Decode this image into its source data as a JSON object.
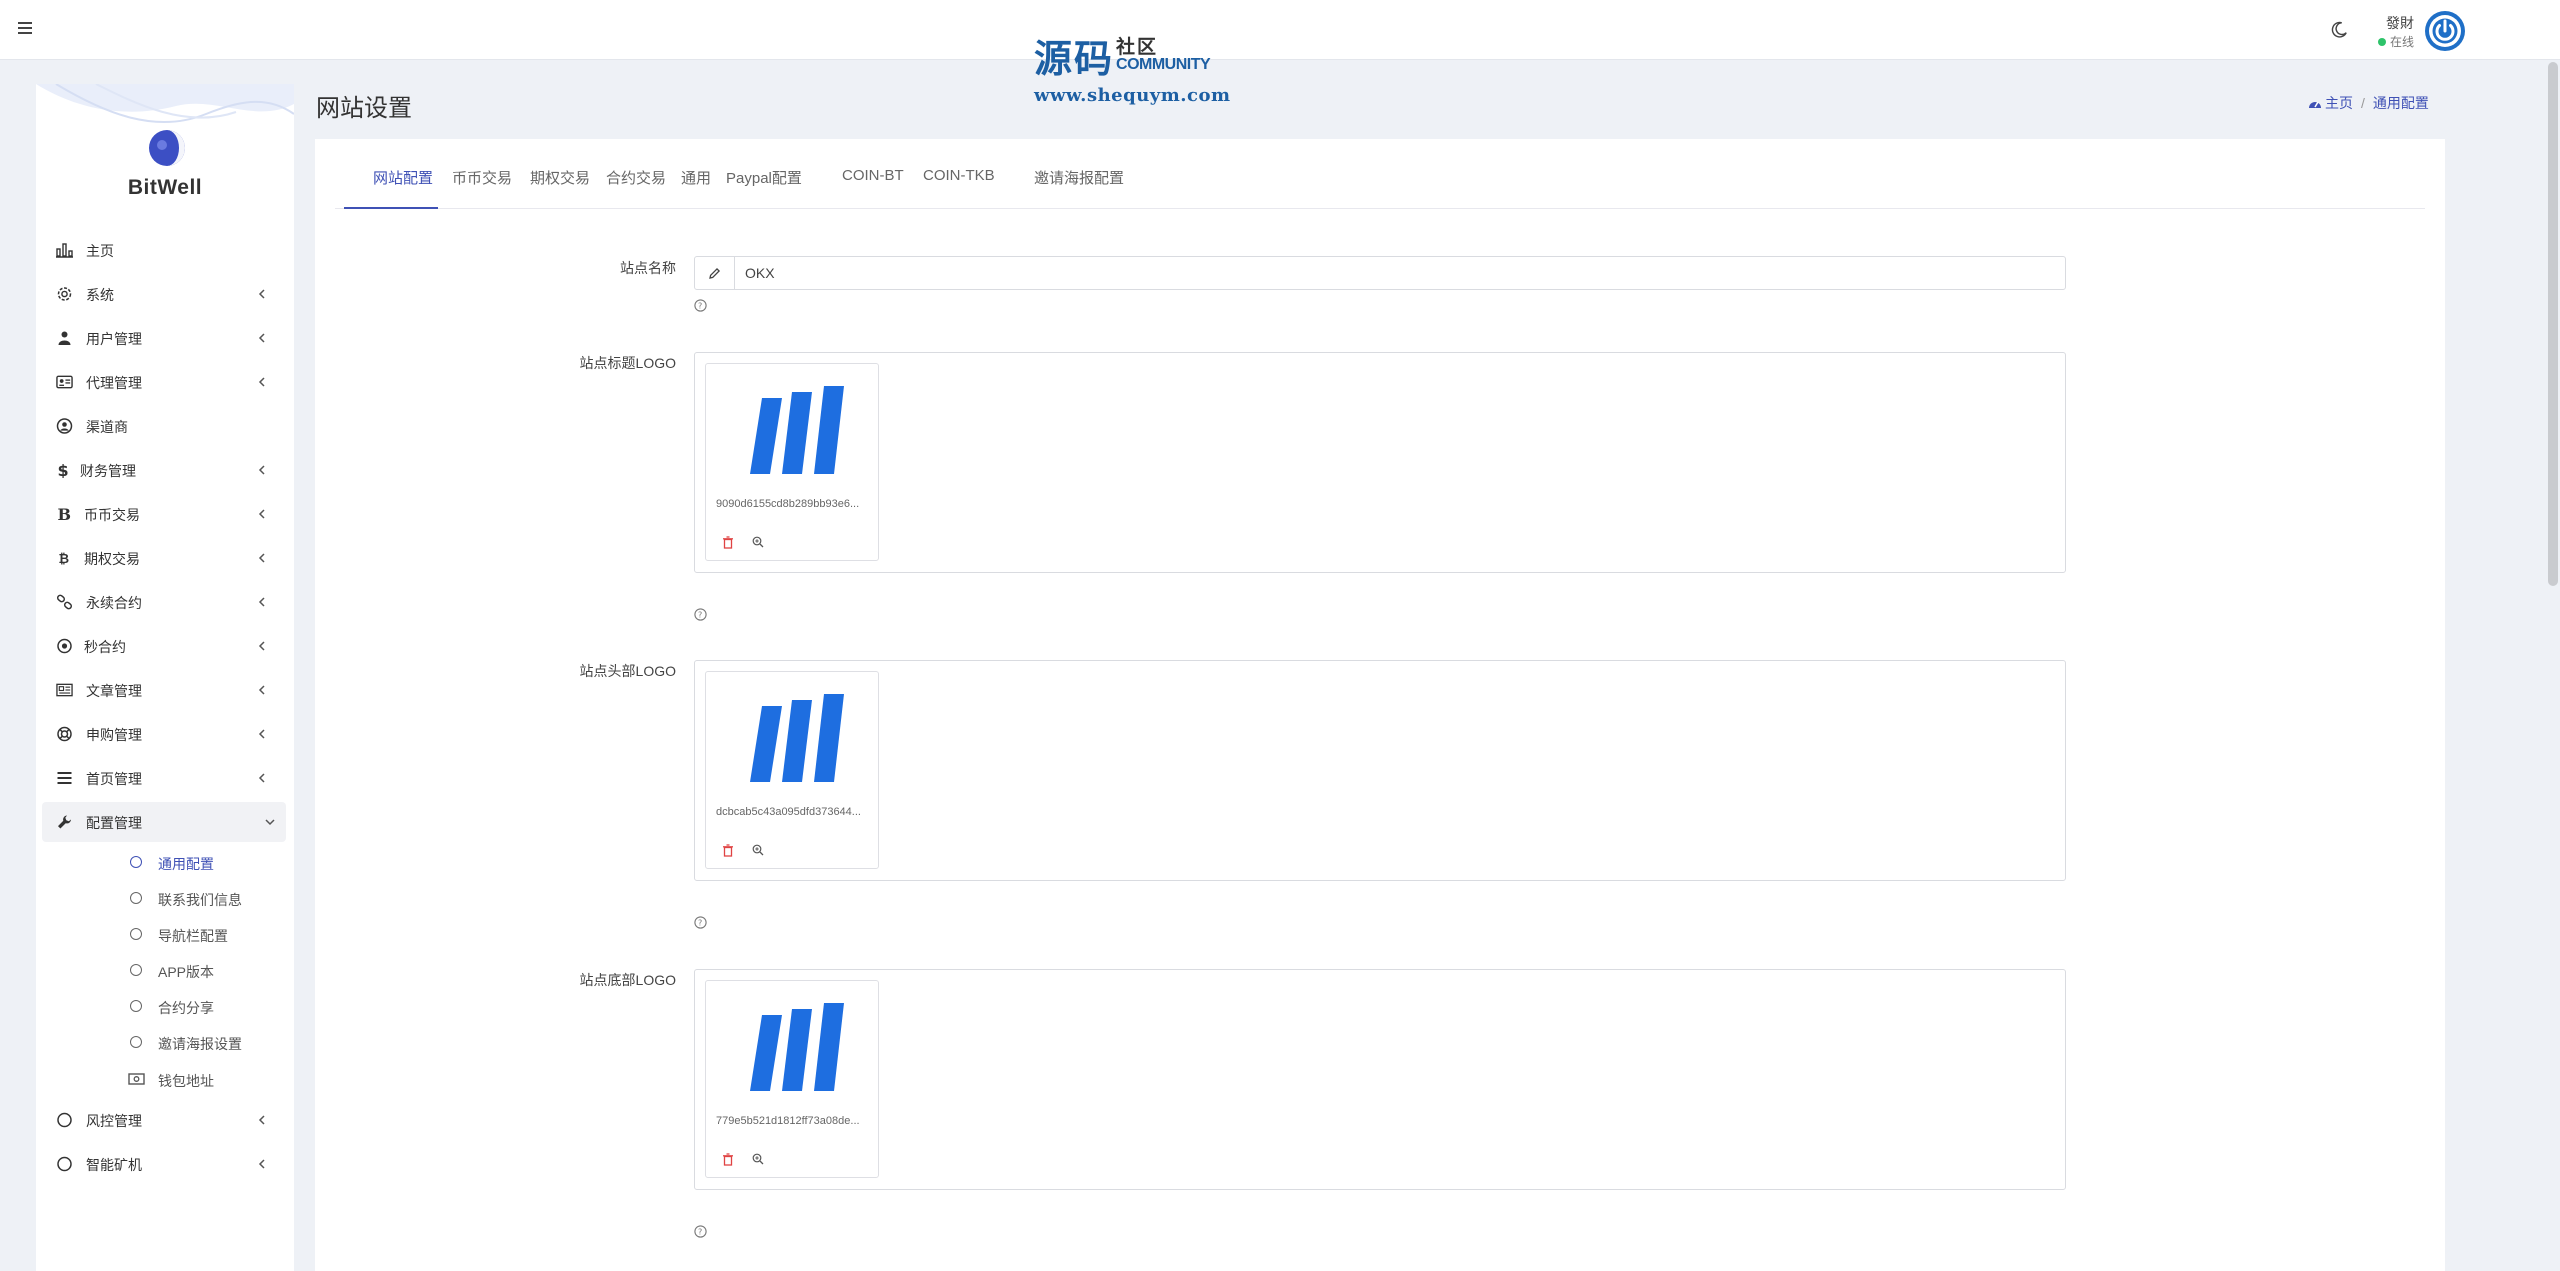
{
  "watermark": {
    "big": "源码",
    "side_cn": "社区",
    "side_en": "COMMUNITY",
    "url": "www.shequym.com"
  },
  "topbar": {
    "menu_icon": "hamburger-icon",
    "theme_icon": "moon-icon",
    "user_name": "發財",
    "user_status": "在线",
    "status_color": "#2ec36a",
    "avatar_icon": "power-icon"
  },
  "sidebar": {
    "brand": "BitWell",
    "items": [
      {
        "label": "主页",
        "icon": "chart-icon",
        "caret": false
      },
      {
        "label": "系统",
        "icon": "gear-icon",
        "caret": true
      },
      {
        "label": "用户管理",
        "icon": "user-icon",
        "caret": true
      },
      {
        "label": "代理管理",
        "icon": "id-card-icon",
        "caret": true
      },
      {
        "label": "渠道商",
        "icon": "user-circle-icon",
        "caret": false
      },
      {
        "label": "财务管理",
        "icon": "dollar-icon",
        "caret": true
      },
      {
        "label": "币币交易",
        "icon": "letter-b-icon",
        "caret": true
      },
      {
        "label": "期权交易",
        "icon": "bitcoin-icon",
        "caret": true
      },
      {
        "label": "永续合约",
        "icon": "link-icon",
        "caret": true
      },
      {
        "label": "秒合约",
        "icon": "dot-circle-icon",
        "caret": true
      },
      {
        "label": "文章管理",
        "icon": "newspaper-icon",
        "caret": true
      },
      {
        "label": "申购管理",
        "icon": "lifebuoy-icon",
        "caret": true
      },
      {
        "label": "首页管理",
        "icon": "list-icon",
        "caret": true
      },
      {
        "label": "配置管理",
        "icon": "wrench-icon",
        "caret": true,
        "expanded": true
      }
    ],
    "sub_items": [
      {
        "label": "通用配置",
        "icon": "circle-icon",
        "current": true
      },
      {
        "label": "联系我们信息",
        "icon": "circle-icon"
      },
      {
        "label": "导航栏配置",
        "icon": "circle-icon"
      },
      {
        "label": "APP版本",
        "icon": "circle-icon"
      },
      {
        "label": "合约分享",
        "icon": "circle-icon"
      },
      {
        "label": "邀请海报设置",
        "icon": "circle-icon"
      },
      {
        "label": "钱包地址",
        "icon": "money-icon"
      }
    ],
    "bottom_items": [
      {
        "label": "风控管理",
        "icon": "circle-icon",
        "caret": true
      },
      {
        "label": "智能矿机",
        "icon": "circle-icon",
        "caret": true
      }
    ]
  },
  "page": {
    "title": "网站设置",
    "breadcrumb": {
      "home": "主页",
      "current": "通用配置",
      "home_icon": "tachometer-icon"
    }
  },
  "tabs": [
    "网站配置",
    "币币交易",
    "期权交易",
    "合约交易",
    "通用",
    "Paypal配置",
    "COIN-BT",
    "COIN-TKB",
    "邀请海报配置"
  ],
  "active_tab": 0,
  "form": {
    "site_name_label": "站点名称",
    "site_name_value": "OKX",
    "logos": [
      {
        "label": "站点标题LOGO",
        "filename": "9090d6155cd8b289bb93e6..."
      },
      {
        "label": "站点头部LOGO",
        "filename": "dcbcab5c43a095dfd373644..."
      },
      {
        "label": "站点底部LOGO",
        "filename": "779e5b521d1812ff73a08de..."
      }
    ],
    "logo_color": "#1e6ee0",
    "delete_icon": "trash-icon",
    "zoom_icon": "zoom-in-icon",
    "help_icon": "question-circle-icon",
    "edit_icon": "pencil-icon"
  }
}
